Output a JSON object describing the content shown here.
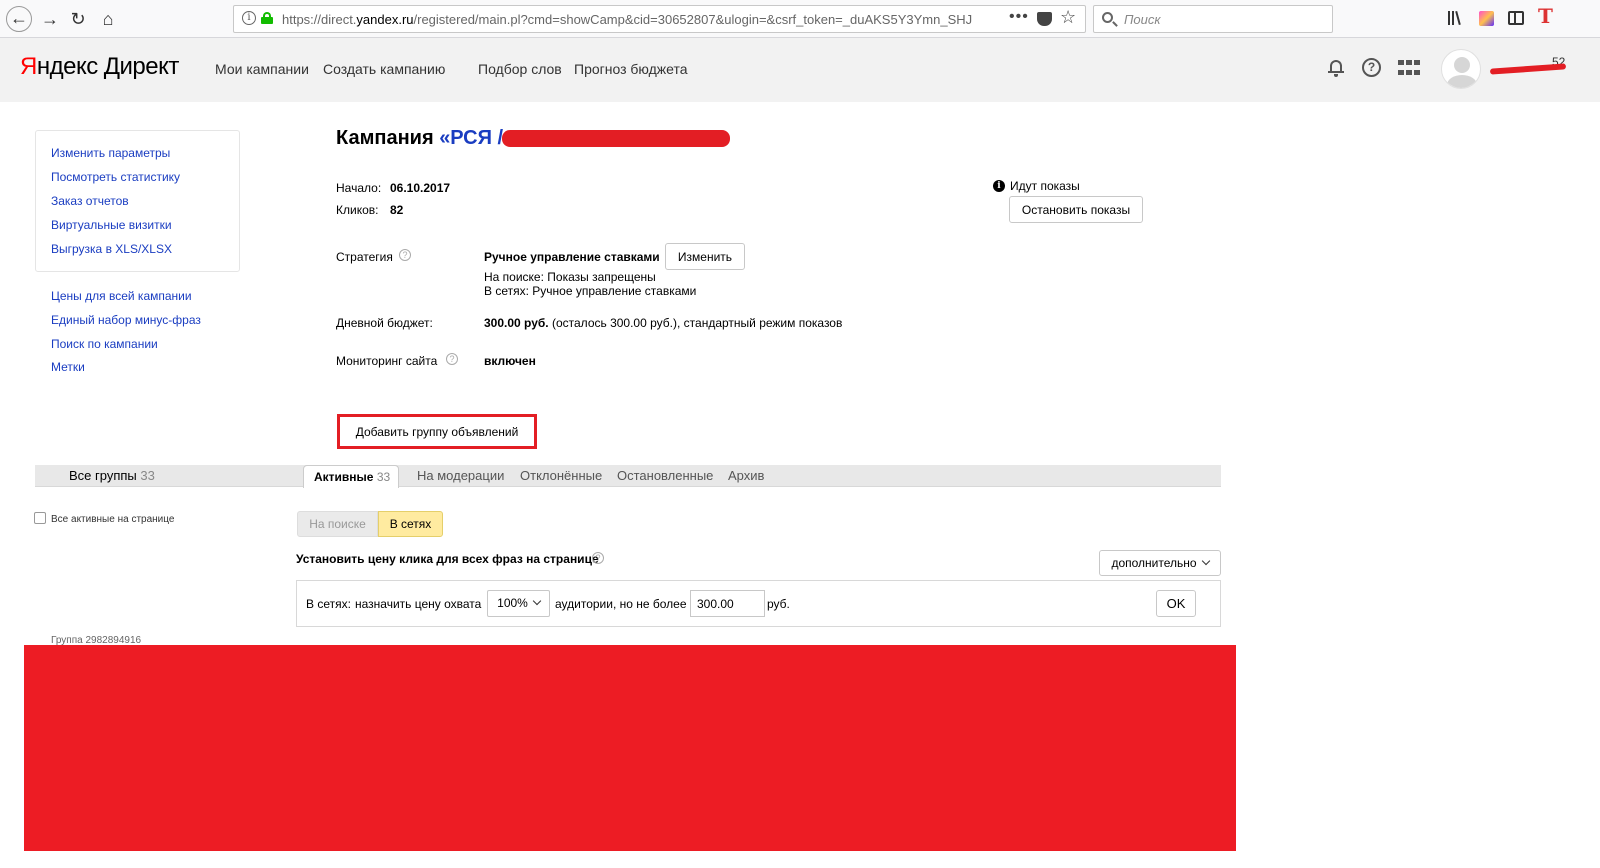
{
  "browser": {
    "url_prefix": "https://direct.",
    "url_domain": "yandex.ru",
    "url_path": "/registered/main.pl?cmd=showCamp&cid=30652807&ulogin=&csrf_token=_duAKS5Y3Ymn_SHJ",
    "more_label": "•••",
    "search_placeholder": "Поиск",
    "icons": [
      "back-icon",
      "forward-icon",
      "reload-icon",
      "home-icon",
      "info-icon",
      "lock-icon",
      "pocket-icon",
      "star-icon",
      "search-icon",
      "library-icon",
      "sidebar-icon"
    ]
  },
  "header": {
    "logo_yandex_first": "Я",
    "logo_yandex_rest": "ндекс",
    "logo_direct": "Директ",
    "nav": [
      "Мои кампании",
      "Создать кампанию",
      "Подбор слов",
      "Прогноз бюджета"
    ],
    "username_tail": "52",
    "accent_color": "#ff0000"
  },
  "sidebar": {
    "box_links": [
      "Изменить параметры",
      "Посмотреть статистику",
      "Заказ отчетов",
      "Виртуальные визитки",
      "Выгрузка в XLS/XLSX"
    ],
    "links": [
      "Цены для всей кампании",
      "Единый набор минус-фраз",
      "Поиск по кампании",
      "Метки"
    ]
  },
  "campaign": {
    "title_prefix": "Кампания ",
    "title_name": "«РСЯ /",
    "start_label": "Начало:",
    "start_value": "06.10.2017",
    "clicks_label": "Кликов:",
    "clicks_value": "82",
    "status_text": "Идут показы",
    "stop_button": "Остановить показы",
    "strategy_label": "Стратегия",
    "strategy_value": "Ручное управление ставками",
    "change_button": "Изменить",
    "strategy_search": "На поиске: Показы запрещены",
    "strategy_networks": "В сетях: Ручное управление ставками",
    "budget_label": "Дневной бюджет:",
    "budget_value": "300.00 руб.",
    "budget_rest": " (осталось 300.00 руб.), стандартный режим показов",
    "monitoring_label": "Мониторинг сайта",
    "monitoring_value": "включен",
    "add_group_button": "Добавить группу объявлений",
    "highlight_color": "#e31e24"
  },
  "tabs": {
    "all_label": "Все группы",
    "all_count": "33",
    "active_label": "Активные",
    "active_count": "33",
    "others": [
      "На модерации",
      "Отклонённые",
      "Остановленные",
      "Архив"
    ]
  },
  "groups": {
    "select_all_label": "Все активные на странице",
    "segment_search": "На поиске",
    "segment_networks": "В сетях",
    "bid_title": "Установить цену клика для всех фраз на странице",
    "more_dropdown": "дополнительно",
    "bid_prefix": "В сетях:",
    "bid_assign": "назначить цену охвата",
    "coverage_value": "100%",
    "bid_mid": "аудитории, но не более",
    "bid_input_value": "300.00",
    "bid_currency": "руб.",
    "ok_button": "OK",
    "group_label": "Группа 2982894916"
  }
}
